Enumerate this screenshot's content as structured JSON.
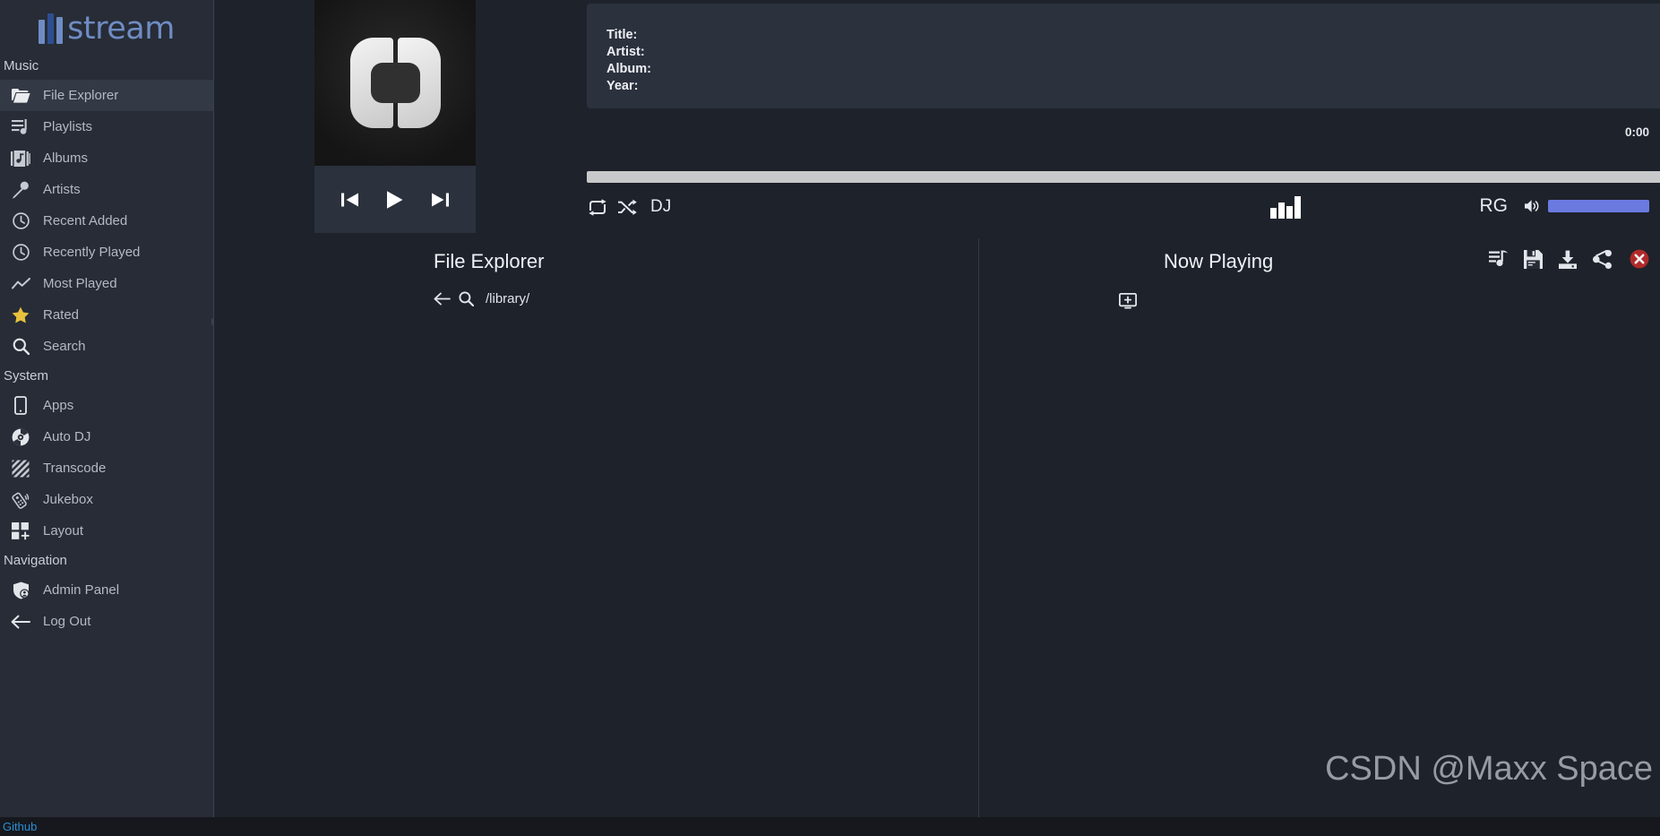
{
  "app": {
    "logo_text": "stream",
    "watermark": "CSDN @Maxx Space"
  },
  "sidebar": {
    "sections": [
      {
        "title": "Music",
        "items": [
          {
            "label": "File Explorer",
            "icon": "folder-icon",
            "active": true
          },
          {
            "label": "Playlists",
            "icon": "playlist-icon",
            "active": false
          },
          {
            "label": "Albums",
            "icon": "albums-icon",
            "active": false
          },
          {
            "label": "Artists",
            "icon": "microphone-icon",
            "active": false
          },
          {
            "label": "Recent Added",
            "icon": "clock-icon",
            "active": false
          },
          {
            "label": "Recently Played",
            "icon": "clock-icon",
            "active": false
          },
          {
            "label": "Most Played",
            "icon": "trending-up-icon",
            "active": false
          },
          {
            "label": "Rated",
            "icon": "star-icon",
            "active": false
          },
          {
            "label": "Search",
            "icon": "search-icon",
            "active": false
          }
        ]
      },
      {
        "title": "System",
        "items": [
          {
            "label": "Apps",
            "icon": "mobile-icon",
            "active": false
          },
          {
            "label": "Auto DJ",
            "icon": "disc-icon",
            "active": false
          },
          {
            "label": "Transcode",
            "icon": "transcode-icon",
            "active": false
          },
          {
            "label": "Jukebox",
            "icon": "remote-icon",
            "active": false
          },
          {
            "label": "Layout",
            "icon": "layout-icon",
            "active": false
          }
        ]
      },
      {
        "title": "Navigation",
        "items": [
          {
            "label": "Admin Panel",
            "icon": "shield-user-icon",
            "active": false
          },
          {
            "label": "Log Out",
            "icon": "arrow-left-icon",
            "active": false
          }
        ]
      }
    ]
  },
  "player": {
    "album_art_alt": "default-album-art",
    "transport": {
      "previous_label": "Previous",
      "play_label": "Play",
      "next_label": "Next"
    },
    "metadata": {
      "title_label": "Title:",
      "artist_label": "Artist:",
      "album_label": "Album:",
      "year_label": "Year:",
      "title_value": "",
      "artist_value": "",
      "album_value": "",
      "year_value": ""
    },
    "time_display": "0:00",
    "progress_percent": 0,
    "controls": {
      "repeat_label": "Repeat",
      "shuffle_label": "Shuffle",
      "dj_label": "DJ",
      "equalizer_label": "Equalizer",
      "replay_gain_label": "RG",
      "volume_percent": 100
    },
    "actions": [
      {
        "label": "Add to Playlist",
        "icon": "playlist-add-icon"
      },
      {
        "label": "Save Playlist",
        "icon": "save-icon"
      },
      {
        "label": "Download",
        "icon": "download-icon"
      },
      {
        "label": "Share",
        "icon": "share-icon"
      },
      {
        "label": "Clear Playlist",
        "icon": "close-circle-icon"
      }
    ],
    "accent_color": "#6b7ae0",
    "close_color": "#b02a2a"
  },
  "file_explorer": {
    "title": "File Explorer",
    "back_label": "Back",
    "search_label": "Search",
    "path": "/library/"
  },
  "now_playing": {
    "title": "Now Playing",
    "add_label": "Add Playlist"
  },
  "footer": {
    "link_label": "Github"
  }
}
